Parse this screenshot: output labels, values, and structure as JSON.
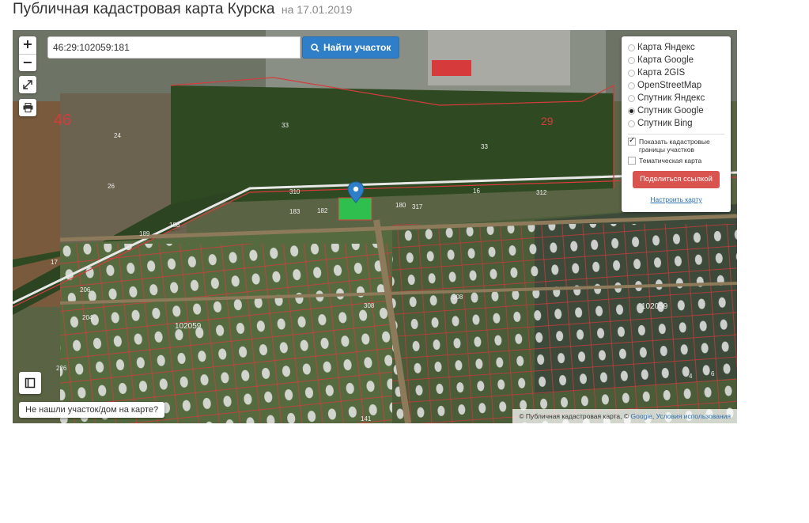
{
  "header": {
    "title": "Публичная кадастровая карта Курска",
    "date": "на 17.01.2019"
  },
  "search": {
    "value": "46:29:102059:181",
    "button_label": "Найти участок"
  },
  "zoom": {
    "plus": "+",
    "minus": "−"
  },
  "layers": {
    "options": [
      {
        "label": "Карта Яндекс",
        "selected": false
      },
      {
        "label": "Карта Google",
        "selected": false
      },
      {
        "label": "Карта 2GIS",
        "selected": false
      },
      {
        "label": "OpenStreetMap",
        "selected": false
      },
      {
        "label": "Спутник Яндекс",
        "selected": false
      },
      {
        "label": "Спутник Google",
        "selected": true
      },
      {
        "label": "Спутник Bing",
        "selected": false
      }
    ],
    "show_borders_label": "Показать кадастровые границы участков",
    "show_borders_checked": true,
    "thematic_label": "Тематическая карта",
    "thematic_checked": false,
    "share_label": "Поделиться ссылкой",
    "configure_label": "Настроить карту"
  },
  "not_found_label": "Не нашли участок/дом на карте?",
  "attribution": {
    "text": "© Публичная кадастровая карта, ©",
    "google_link": "Google",
    "terms_link": "Условия использования"
  },
  "map_labels": {
    "district_46": "46",
    "district_29": "29",
    "quarter_a": "102059",
    "quarter_b": "102059",
    "parcels": [
      "33",
      "33",
      "24",
      "26",
      "310",
      "183",
      "182",
      "180",
      "317",
      "16",
      "312",
      "189",
      "188",
      "17",
      "206",
      "204",
      "308",
      "308",
      "226",
      "141",
      "4",
      "6",
      "39"
    ]
  },
  "colors": {
    "accent": "#2f7fc8",
    "share": "#d9534f",
    "boundary": "#e03c3c",
    "selected_parcel": "#2fbf4f"
  }
}
